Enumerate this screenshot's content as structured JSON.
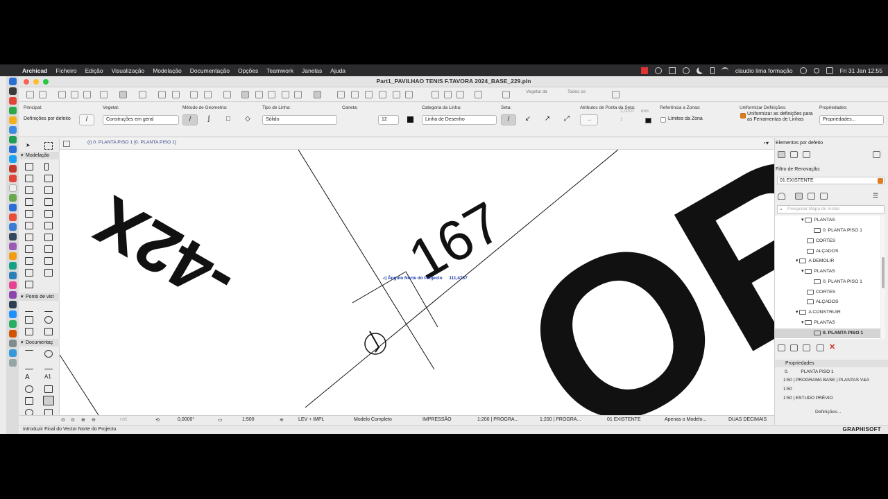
{
  "menubar": {
    "app": "Archicad",
    "items": [
      "Ficheiro",
      "Edição",
      "Visualização",
      "Modelação",
      "Documentação",
      "Opções",
      "Teamwork",
      "Janelas",
      "Ajuda"
    ],
    "user": "claudio lima formação",
    "clock": "Fri 31 Jan  12:55"
  },
  "window": {
    "title": "Part1_PAVILHAO TENIS F.TAVORA 2024_BASE_229.pln"
  },
  "toolbar": {
    "vegetal_label": "Vegetal da",
    "todos_label": "Todos os"
  },
  "infobox": {
    "principal_label": "Principal:",
    "principal_value": "Definições por defeito",
    "vegetal_label": "Vegetal:",
    "vegetal_value": "Construções em geral",
    "metodo_label": "Método de Geometria:",
    "tipo_linha_label": "Tipo de Linha:",
    "tipo_linha_value": "Sólido",
    "caneta_label": "Caneta:",
    "caneta_value": "12",
    "categoria_label": "Categoria da Linha:",
    "categoria_value": "Linha de Desenho",
    "seta_label": "Seta:",
    "atributos_label": "Atributos de Ponta da Seta:",
    "seta_size": "2,0000",
    "seta_unit": "mm",
    "seta_count": "1",
    "referencia_label": "Referência a Zonas:",
    "limites_label": "Limites da Zona",
    "uniformizar_label": "Uniformizar Definições:",
    "uniformizar_text_1": "Uniformizar as definições para",
    "uniformizar_text_2": "as Ferramentas de Linhas",
    "propriedades_label": "Propriedades:",
    "propriedades_btn": "Propriedades..."
  },
  "toolbox": {
    "modelacao": "Modelação",
    "ponto_vista": "Ponto de vist",
    "documentacao": "Documentaç"
  },
  "view_tab": {
    "label": "(I) 0. PLANTA PISO 1 [0. PLANTA PISO 1]"
  },
  "canvas": {
    "tooltip_label": "Ângulo Norte do Projecto",
    "tooltip_value": "111,4737",
    "text_top_left": "-42X",
    "text_top_mid": "167",
    "text_big": "OR"
  },
  "quickbar": {
    "angle": "0,0000°",
    "scale": "1:500",
    "layer_combo": "LEV + IMPL",
    "model_view": "Modelo Completo",
    "pen_set": "IMPRESSÃO",
    "override_1": "1:200 | PROGRA...",
    "override_2": "1:200 | PROGRA...",
    "renovation": "01 EXISTENTE",
    "model_only": "Apenas o Modelo...",
    "dimension": "DUAS DECIMAIS",
    "zoom_placeholder": "n/d"
  },
  "status": {
    "message": "Introduzir Final do Vector Norte do Projecto.",
    "brand": "GRAPHISOFT"
  },
  "navigator": {
    "title": "Elementos por defeito",
    "filtro_label": "Filtro de Renovação:",
    "filtro_value": "01 EXISTENTE",
    "search_placeholder": "Pesquisar Mapa de Vistas",
    "tree": [
      {
        "label": "PLANTAS",
        "level": 3,
        "expanded": true
      },
      {
        "label": "0. PLANTA PISO 1",
        "level": 4
      },
      {
        "label": "CORTES",
        "level": 3
      },
      {
        "label": "ALÇADOS",
        "level": 3
      },
      {
        "label": "A DEMOLIR",
        "level": 2,
        "expanded": true
      },
      {
        "label": "PLANTAS",
        "level": 3,
        "expanded": true
      },
      {
        "label": "0. PLANTA PISO 1",
        "level": 4
      },
      {
        "label": "CORTES",
        "level": 3
      },
      {
        "label": "ALÇADOS",
        "level": 3
      },
      {
        "label": "A CONSTRUIR",
        "level": 2,
        "expanded": true
      },
      {
        "label": "PLANTAS",
        "level": 3,
        "expanded": true
      },
      {
        "label": "0. PLANTA PISO 1",
        "level": 4,
        "selected": true
      }
    ],
    "props_title": "Propriedades",
    "props": {
      "id": "0.",
      "name": "PLANTA PISO 1",
      "override": "1:50 | PROGRAMA BASE | PLANTAS V&A",
      "scale": "1:50",
      "phase": "1:50 | ESTUDO PRÉVIO"
    },
    "definicoes_btn": "Definições..."
  },
  "colors": {
    "accent": "#e07b20",
    "selection_blue": "#1a3aa8"
  }
}
